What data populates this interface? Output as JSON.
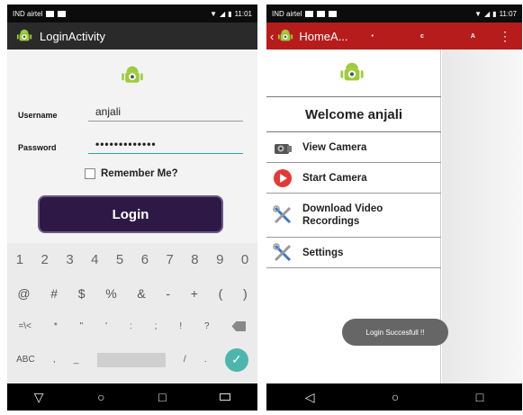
{
  "left": {
    "status": {
      "carrier": "IND airtel",
      "time": "11:01"
    },
    "actionbar": {
      "title": "LoginActivity"
    },
    "form": {
      "username_label": "Username",
      "username_value": "anjali",
      "password_label": "Password",
      "password_value": "•••••••••••••",
      "remember_label": "Remember Me?",
      "login_label": "Login"
    },
    "keyboard": {
      "row1": [
        "1",
        "2",
        "3",
        "4",
        "5",
        "6",
        "7",
        "8",
        "9",
        "0"
      ],
      "row2": [
        "@",
        "#",
        "$",
        "%",
        "&",
        "-",
        "+",
        "(",
        ")"
      ],
      "row3": [
        "=\\<",
        "*",
        "\"",
        "'",
        ":",
        ";",
        "!",
        "?"
      ],
      "row4": [
        "ABC",
        ",",
        "_",
        "/",
        "."
      ]
    }
  },
  "right": {
    "status": {
      "carrier": "IND airtel",
      "time": "11:07"
    },
    "actionbar": {
      "title": "HomeA...",
      "items": [
        "•",
        "c",
        "A"
      ]
    },
    "drawer": {
      "welcome": "Welcome anjali",
      "items": [
        {
          "label": "View Camera",
          "icon": "camera-icon"
        },
        {
          "label": "Start Camera",
          "icon": "play-icon"
        },
        {
          "label": "Download Video Recordings",
          "icon": "tools-icon"
        },
        {
          "label": "Settings",
          "icon": "settings-tools-icon"
        }
      ]
    },
    "toast": "Login Succesfull !!"
  },
  "colors": {
    "login_button": "#2d1846",
    "home_actionbar": "#b71c1c",
    "accent": "#26a7a1",
    "android_green": "#9ccc3c"
  }
}
